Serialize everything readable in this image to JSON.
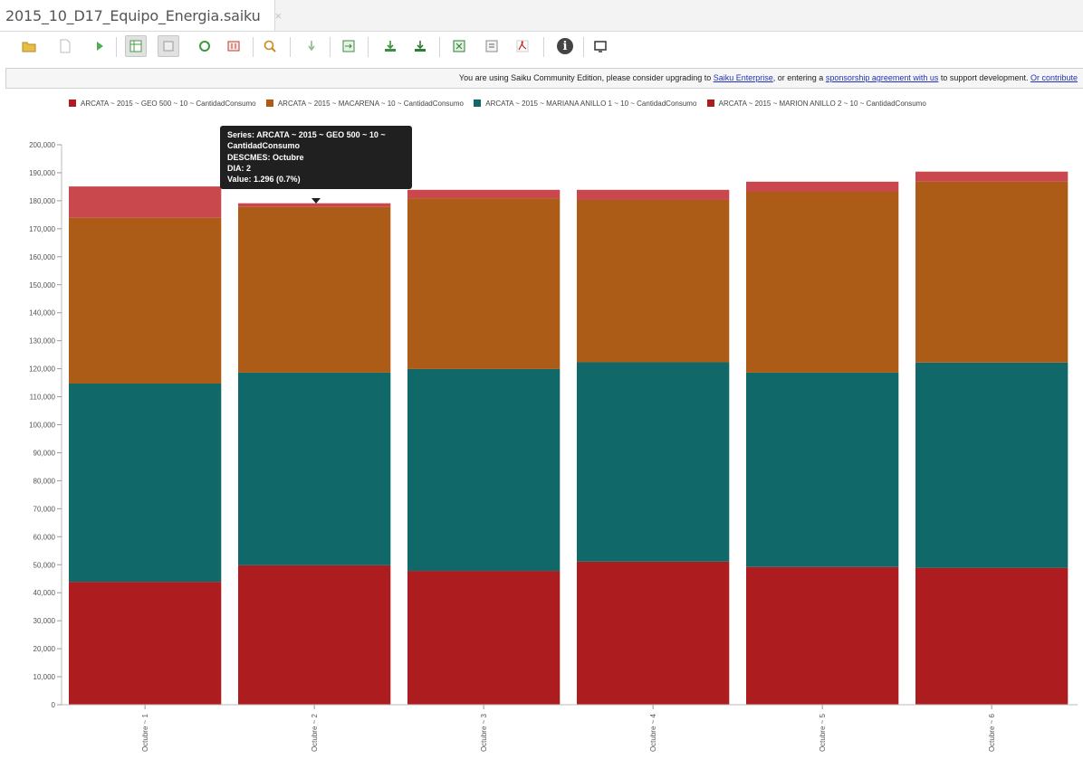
{
  "tab": {
    "title": "2015_10_D17_Equipo_Energia.saiku",
    "close": "×"
  },
  "toolbar": {
    "buttons": [
      {
        "name": "open-query-icon",
        "color": "#d9a623"
      },
      {
        "name": "new-query-icon",
        "color": "#bbbbbb"
      },
      {
        "name": "run-query-icon",
        "color": "#4caf50"
      },
      {
        "name": "toggle-fields-icon",
        "color": "#4a9a4a"
      },
      {
        "name": "toggle-sidebar-icon",
        "color": "#9a9a9a"
      },
      {
        "name": "automatic-execution-icon",
        "color": "#3c9a3c"
      },
      {
        "name": "swap-axis-icon",
        "color": "#c0392b"
      },
      {
        "name": "zoom-icon",
        "color": "#c98a1a"
      },
      {
        "name": "drillthrough-icon",
        "color": "#88bb88"
      },
      {
        "name": "show-mdx-icon",
        "color": "#3c8d3c"
      },
      {
        "name": "export-icon",
        "color": "#3c8d3c"
      },
      {
        "name": "export-drillthrough-icon",
        "color": "#3c8d3c"
      },
      {
        "name": "export-xls-icon",
        "color": "#2e7d32"
      },
      {
        "name": "export-csv-icon",
        "color": "#666666"
      },
      {
        "name": "export-pdf-icon",
        "color": "#cc2222"
      },
      {
        "name": "about-icon",
        "color": "#444444"
      },
      {
        "name": "fullscreen-icon",
        "color": "#333333"
      }
    ],
    "info_glyph": "i"
  },
  "banner": {
    "text1": "You are using Saiku Community Edition, please consider upgrading to ",
    "link1": "Saiku Enterprise",
    "text2": ", or entering a ",
    "link2": "sponsorship agreement with us",
    "text3": " to support development. ",
    "link3": "Or contribute"
  },
  "legend": [
    {
      "label": "ARCATA ~ 2015 ~ GEO 500 ~ 10 ~ CantidadConsumo",
      "color": "#ad1c1f"
    },
    {
      "label": "ARCATA ~ 2015 ~ MACARENA ~ 10 ~ CantidadConsumo",
      "color": "#ad5c18"
    },
    {
      "label": "ARCATA ~ 2015 ~ MARIANA ANILLO 1 ~ 10 ~ CantidadConsumo",
      "color": "#116868"
    },
    {
      "label": "ARCATA ~ 2015 ~ MARION ANILLO 2 ~ 10 ~ CantidadConsumo",
      "color": "#ad1c1f"
    }
  ],
  "tooltip": {
    "series_label": "Series:",
    "series_value": "ARCATA ~ 2015 ~ GEO 500 ~ 10 ~ CantidadConsumo",
    "descmes_label": "DESCMES:",
    "descmes_value": "Octubre",
    "dia_label": "DIA:",
    "dia_value": "2",
    "value_label": "Value:",
    "value_value": "1.296 (0.7%)"
  },
  "chart_data": {
    "type": "bar",
    "stacked": true,
    "categories": [
      "Octubre ~ 1",
      "Octubre ~ 2",
      "Octubre ~ 3",
      "Octubre ~ 4",
      "Octubre ~ 5",
      "Octubre ~ 6"
    ],
    "series": [
      {
        "color": "#ad1c1f",
        "values": [
          43900,
          49800,
          47800,
          51100,
          49200,
          48900
        ]
      },
      {
        "color": "#116868",
        "values": [
          70800,
          68800,
          72100,
          71200,
          69400,
          73300
        ]
      },
      {
        "color": "#ad5c18",
        "values": [
          59200,
          59200,
          61000,
          58000,
          64600,
          64600
        ]
      },
      {
        "color": "#c8484e",
        "values": [
          11200,
          1296,
          3000,
          3600,
          3600,
          3600
        ]
      }
    ],
    "y_ticks": [
      "0",
      "10,000",
      "20,000",
      "30,000",
      "40,000",
      "50,000",
      "60,000",
      "70,000",
      "80,000",
      "90,000",
      "100,000",
      "110,000",
      "120,000",
      "130,000",
      "140,000",
      "150,000",
      "160,000",
      "170,000",
      "180,000",
      "190,000",
      "200,000"
    ],
    "ylim": [
      0,
      200000
    ],
    "grid": false,
    "legend_position": "top"
  }
}
